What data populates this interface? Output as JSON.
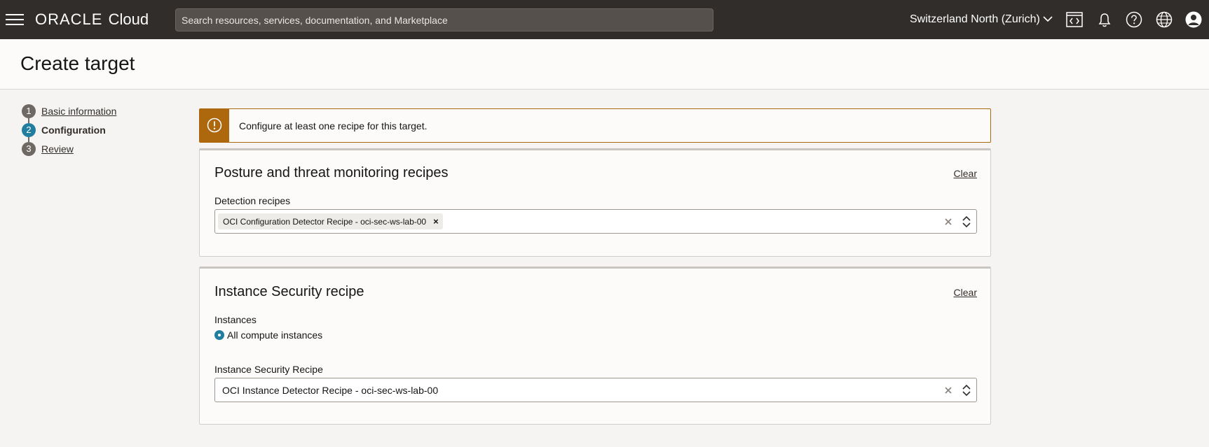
{
  "topbar": {
    "logo_brand": "ORACLE",
    "logo_product": "Cloud",
    "search_placeholder": "Search resources, services, documentation, and Marketplace",
    "region": "Switzerland North (Zurich)",
    "icons": [
      "hamburger-icon",
      "chevron-down-icon",
      "code-editor-icon",
      "bell-icon",
      "help-icon",
      "globe-icon",
      "user-avatar-icon"
    ]
  },
  "page": {
    "title": "Create target"
  },
  "steps": [
    {
      "number": "1",
      "label": "Basic information",
      "state": "link"
    },
    {
      "number": "2",
      "label": "Configuration",
      "state": "active"
    },
    {
      "number": "3",
      "label": "Review",
      "state": "link"
    }
  ],
  "alert": {
    "icon": "warning-icon",
    "message": "Configure at least one recipe for this target."
  },
  "posture_panel": {
    "title": "Posture and threat monitoring recipes",
    "clear_label": "Clear",
    "field_label": "Detection recipes",
    "chips": [
      {
        "label": "OCI Configuration Detector Recipe - oci-sec-ws-lab-00",
        "remove": "×"
      }
    ]
  },
  "instance_panel": {
    "title": "Instance Security recipe",
    "clear_label": "Clear",
    "instances_label": "Instances",
    "instances_option": "All compute instances",
    "recipe_label": "Instance Security Recipe",
    "recipe_value": "OCI Instance Detector Recipe - oci-sec-ws-lab-00"
  },
  "colors": {
    "topbar_bg": "#312d2a",
    "warning": "#ad670d",
    "active_step": "#227e9e",
    "page_bg": "#f5f4f2"
  }
}
